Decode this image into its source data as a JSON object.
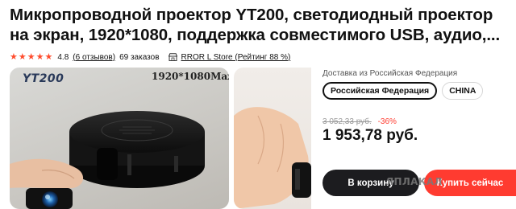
{
  "product": {
    "title": "Микропроводной проектор YT200, светодиодный проектор на экран, 1920*1080, поддержка совместимого USB, аудио,...",
    "rating": "4.8",
    "reviews": "(6 отзывов)",
    "orders": "69 заказов",
    "store": "RROR L Store (Рейтинг 88 %)",
    "stars_filled": 5,
    "star_glyph": "★"
  },
  "gallery": {
    "model_label": "YT200",
    "resolution_label": "1920*1080Max"
  },
  "shipping": {
    "label": "Доставка из Российская Федерация",
    "options": [
      "Российская Федерация",
      "CHINA"
    ],
    "selected": "Российская Федерация"
  },
  "pricing": {
    "old_price": "3 052,33 руб.",
    "discount": "-36%",
    "price": "1 953,78 руб."
  },
  "actions": {
    "cart_label": "В корзину",
    "buy_label": "Купить сейчас"
  },
  "watermark": "ЯПЛАКАЛ",
  "colors": {
    "accent": "#ff3b30",
    "star": "#ff4d2e",
    "dark_button": "#1c1c1f"
  },
  "icons": [
    "star-icon",
    "store-icon",
    "projector-image"
  ]
}
